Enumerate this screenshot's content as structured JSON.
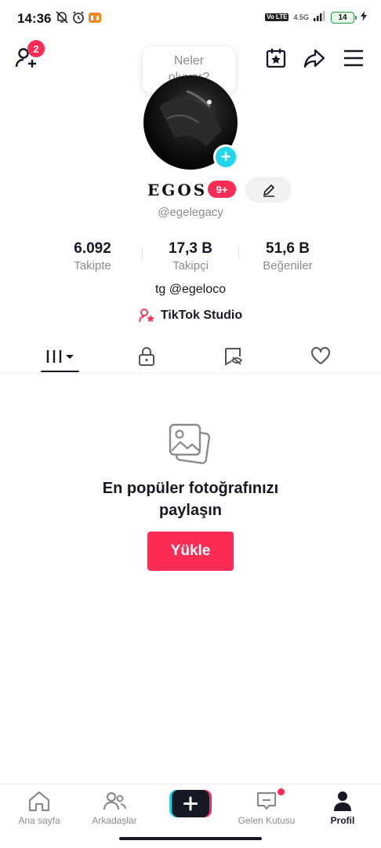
{
  "status_bar": {
    "time": "14:36",
    "volte": "Vo LTE",
    "network": "4.5G",
    "battery": "14"
  },
  "note_bubble": {
    "line1": "Neler",
    "line2": "oluyor?"
  },
  "header": {
    "friend_requests_count": "2"
  },
  "profile": {
    "display_name": "EGOS",
    "badge": "9+",
    "username": "@egelegacy",
    "bio": "tg @egeloco",
    "studio_link": "TikTok Studio"
  },
  "stats": [
    {
      "value": "6.092",
      "label": "Takipte"
    },
    {
      "value": "17,3 B",
      "label": "Takipçi"
    },
    {
      "value": "51,6 B",
      "label": "Beğeniler"
    }
  ],
  "tabs": [
    {
      "icon": "grid-icon",
      "active": true
    },
    {
      "icon": "lock-icon",
      "active": false
    },
    {
      "icon": "hidden-reposts-icon",
      "active": false
    },
    {
      "icon": "heart-icon",
      "active": false
    }
  ],
  "empty_state": {
    "title_line1": "En popüler fotoğrafınızı",
    "title_line2": "paylaşın",
    "button_label": "Yükle"
  },
  "bottom_nav": {
    "items": [
      {
        "label": "Ana sayfa",
        "icon": "home-icon",
        "active": false
      },
      {
        "label": "Arkadaşlar",
        "icon": "friends-icon",
        "active": false
      },
      {
        "label": "",
        "icon": "create-icon",
        "active": false
      },
      {
        "label": "Gelen Kutusu",
        "icon": "inbox-icon",
        "active": false
      },
      {
        "label": "Profil",
        "icon": "profile-icon",
        "active": true
      }
    ]
  },
  "colors": {
    "accent": "#fe2c55",
    "cyan": "#20d5ec",
    "text_primary": "#161823",
    "text_secondary": "#8a8b91"
  }
}
